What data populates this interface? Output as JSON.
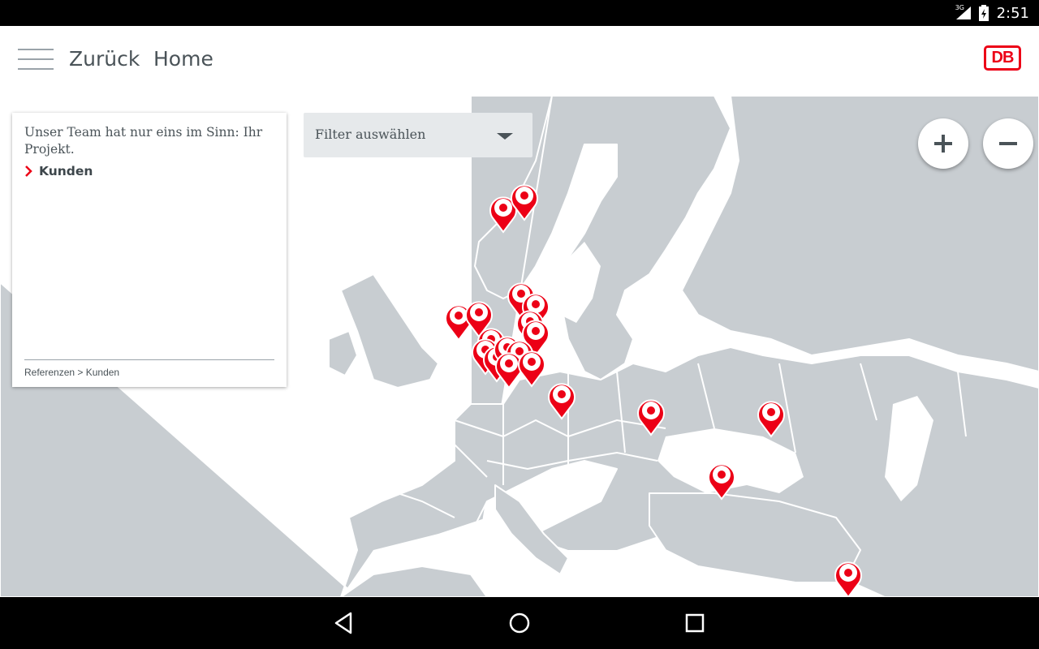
{
  "status_bar": {
    "time": "2:51",
    "network": "3G"
  },
  "header": {
    "back_label": "Zurück",
    "home_label": "Home",
    "logo_text": "DB"
  },
  "info_panel": {
    "text": "Unser Team hat nur eins im Sinn: Ihr Projekt.",
    "link_label": "Kunden",
    "breadcrumb": "Referenzen > Kunden"
  },
  "filter": {
    "label": "Filter auswählen"
  },
  "zoom": {
    "in_label": "+",
    "out_label": "−"
  },
  "colors": {
    "accent": "#ec0016",
    "land": "#c8cdd1",
    "text": "#4a5358"
  },
  "icons": [
    "menu-icon",
    "chevron-right-icon",
    "dropdown-arrow-icon",
    "zoom-in-icon",
    "zoom-out-icon",
    "map-pin-icon",
    "back-icon",
    "home-icon",
    "recents-icon"
  ]
}
